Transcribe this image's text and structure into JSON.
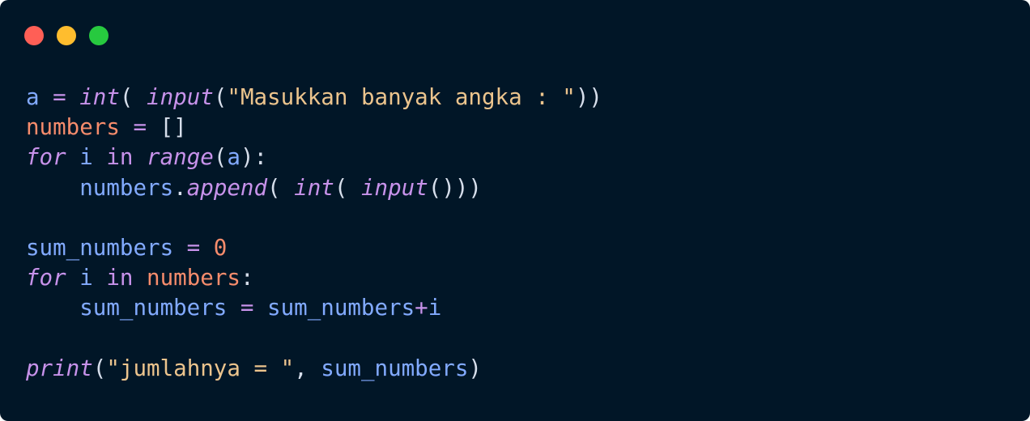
{
  "window": {
    "background": "#011627",
    "controls": [
      {
        "name": "close-button",
        "color": "#ff5f56"
      },
      {
        "name": "minimize-button",
        "color": "#ffbd2e"
      },
      {
        "name": "maximize-button",
        "color": "#27c93f"
      }
    ]
  },
  "colors": {
    "variable": "#82aaff",
    "keyword": "#c792ea",
    "string": "#ecc48d",
    "assigned": "#f78c6c",
    "number": "#f78c6c",
    "punctuation": "#d6deeb",
    "operator": "#c792ea"
  },
  "code_lines": [
    [
      {
        "t": "a",
        "c": "variable"
      },
      {
        "t": " = ",
        "c": "operator"
      },
      {
        "t": "int",
        "c": "keyword",
        "i": true
      },
      {
        "t": "(",
        "c": "punctuation"
      },
      {
        "t": " ",
        "c": "punctuation"
      },
      {
        "t": "input",
        "c": "keyword",
        "i": true
      },
      {
        "t": "(",
        "c": "punctuation"
      },
      {
        "t": "\"Masukkan banyak angka : \"",
        "c": "string"
      },
      {
        "t": "))",
        "c": "punctuation"
      }
    ],
    [
      {
        "t": "numbers",
        "c": "assigned"
      },
      {
        "t": " = ",
        "c": "operator"
      },
      {
        "t": "[]",
        "c": "punctuation"
      }
    ],
    [
      {
        "t": "for",
        "c": "keyword",
        "i": true
      },
      {
        "t": " ",
        "c": "punctuation"
      },
      {
        "t": "i",
        "c": "variable"
      },
      {
        "t": " ",
        "c": "punctuation"
      },
      {
        "t": "in",
        "c": "keyword"
      },
      {
        "t": " ",
        "c": "punctuation"
      },
      {
        "t": "range",
        "c": "keyword",
        "i": true
      },
      {
        "t": "(",
        "c": "punctuation"
      },
      {
        "t": "a",
        "c": "variable"
      },
      {
        "t": "):",
        "c": "punctuation"
      }
    ],
    [
      {
        "t": "    ",
        "c": "punctuation"
      },
      {
        "t": "numbers",
        "c": "variable"
      },
      {
        "t": ".",
        "c": "punctuation"
      },
      {
        "t": "append",
        "c": "keyword",
        "i": true
      },
      {
        "t": "(",
        "c": "punctuation"
      },
      {
        "t": " ",
        "c": "punctuation"
      },
      {
        "t": "int",
        "c": "keyword",
        "i": true
      },
      {
        "t": "(",
        "c": "punctuation"
      },
      {
        "t": " ",
        "c": "punctuation"
      },
      {
        "t": "input",
        "c": "keyword",
        "i": true
      },
      {
        "t": "()))",
        "c": "punctuation"
      }
    ],
    [],
    [
      {
        "t": "sum_numbers",
        "c": "variable"
      },
      {
        "t": " = ",
        "c": "operator"
      },
      {
        "t": "0",
        "c": "number"
      }
    ],
    [
      {
        "t": "for",
        "c": "keyword",
        "i": true
      },
      {
        "t": " ",
        "c": "punctuation"
      },
      {
        "t": "i",
        "c": "variable"
      },
      {
        "t": " ",
        "c": "punctuation"
      },
      {
        "t": "in",
        "c": "keyword"
      },
      {
        "t": " ",
        "c": "punctuation"
      },
      {
        "t": "numbers",
        "c": "assigned"
      },
      {
        "t": ":",
        "c": "punctuation"
      }
    ],
    [
      {
        "t": "    ",
        "c": "punctuation"
      },
      {
        "t": "sum_numbers",
        "c": "variable"
      },
      {
        "t": " = ",
        "c": "operator"
      },
      {
        "t": "sum_numbers",
        "c": "variable"
      },
      {
        "t": "+",
        "c": "operator"
      },
      {
        "t": "i",
        "c": "variable"
      }
    ],
    [],
    [
      {
        "t": "print",
        "c": "keyword",
        "i": true
      },
      {
        "t": "(",
        "c": "punctuation"
      },
      {
        "t": "\"jumlahnya = \"",
        "c": "string"
      },
      {
        "t": ", ",
        "c": "punctuation"
      },
      {
        "t": "sum_numbers",
        "c": "variable"
      },
      {
        "t": ")",
        "c": "punctuation"
      }
    ]
  ]
}
